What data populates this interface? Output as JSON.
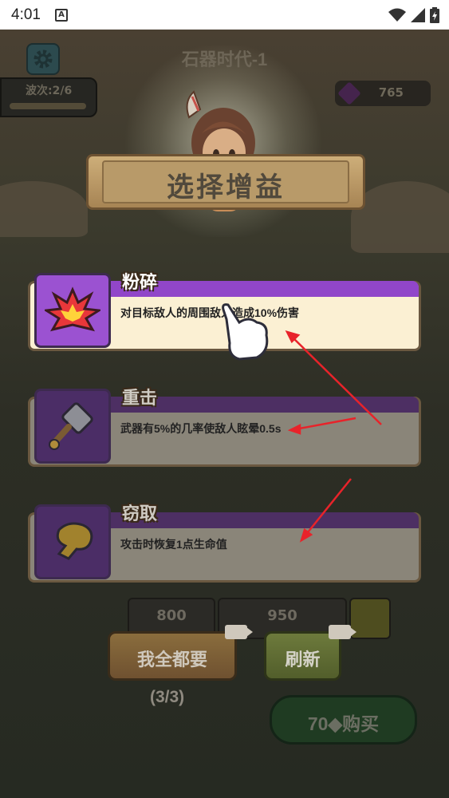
{
  "status_bar": {
    "time": "4:01"
  },
  "game": {
    "level_title": "石器时代-1",
    "wave_label": "波次:2/6",
    "gem_count": "765"
  },
  "dialog": {
    "title": "选择增益",
    "options": [
      {
        "name": "粉碎",
        "description": "对目标敌人的周围敌人造成10%伤害",
        "icon": "explosion-icon",
        "selected": true
      },
      {
        "name": "重击",
        "description": "武器有5%的几率使敌人眩晕0.5s",
        "icon": "hammer-icon",
        "selected": false
      },
      {
        "name": "窃取",
        "description": "攻击时恢复1点生命值",
        "icon": "glove-icon",
        "selected": false
      }
    ]
  },
  "shop": {
    "prices": [
      "800",
      "950"
    ]
  },
  "buttons": {
    "take_all": "我全都要",
    "refresh": "刷新",
    "counter": "(3/3)",
    "buy_price": "70",
    "buy_label": "购买"
  },
  "colors": {
    "selected_card": "#fbf0d3",
    "purple_strip": "#9146c9",
    "arrow": "#e8232a"
  }
}
